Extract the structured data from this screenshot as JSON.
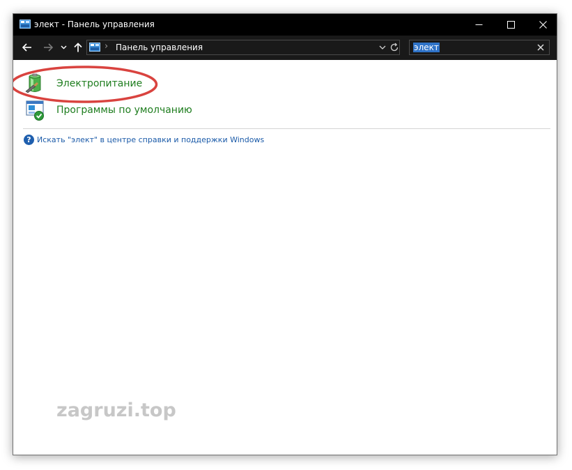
{
  "window": {
    "title": "элект - Панель управления"
  },
  "address_bar": {
    "path": "Панель управления"
  },
  "search": {
    "value": "элект"
  },
  "results": [
    {
      "label": "Электропитание",
      "icon": "power-options-icon"
    },
    {
      "label": "Программы по умолчанию",
      "icon": "default-programs-icon"
    }
  ],
  "help": {
    "link_text": "Искать \"элект\" в центре справки и поддержки Windows"
  },
  "watermark": {
    "text": "zagruzi.top"
  },
  "colors": {
    "titlebar": "#000000",
    "navbar": "#191919",
    "result_link": "#1e7d1e",
    "help_link": "#1a5aa8",
    "search_selection": "#2f73c8",
    "highlight_ellipse": "#d9433f"
  }
}
